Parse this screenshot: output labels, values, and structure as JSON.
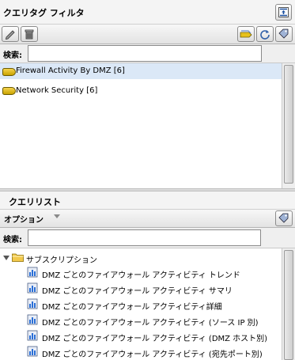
{
  "filter_panel": {
    "title": "クエリタグ フィルタ",
    "search_label": "検索:",
    "search_value": "",
    "tags": [
      {
        "label": "Firewall Activity By DMZ [6]",
        "selected": true
      },
      {
        "label": "Network Security [6]",
        "selected": false
      }
    ]
  },
  "query_panel": {
    "title": "クエリリスト",
    "options_label": "オプション",
    "search_label": "検索:",
    "search_value": "",
    "folder": {
      "label": "サブスクリプション",
      "items": [
        "DMZ ごとのファイアウォール アクティビティ トレンド",
        "DMZ ごとのファイアウォール アクティビティ サマリ",
        "DMZ ごとのファイアウォール アクティビティ詳細",
        "DMZ ごとのファイアウォール アクティビティ (ソース IP 別)",
        "DMZ ごとのファイアウォール アクティビティ (DMZ ホスト別)",
        "DMZ ごとのファイアウォール アクティビティ (宛先ポート別)"
      ]
    }
  },
  "colors": {
    "selection": "#dbe8f7",
    "folder": "#f2c94c",
    "tag": "#e8c21c"
  }
}
